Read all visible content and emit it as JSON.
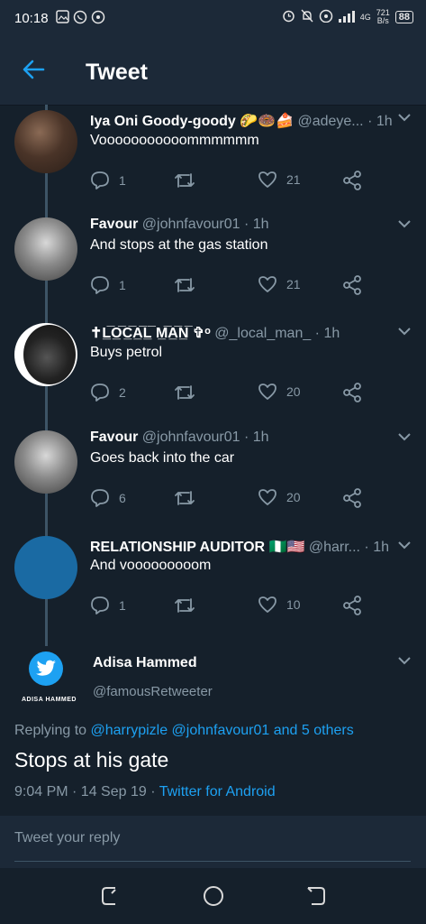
{
  "status_bar": {
    "time": "10:18",
    "net_type": "4G",
    "speed_value": "721",
    "speed_unit": "B/s",
    "battery": "88"
  },
  "header": {
    "title": "Tweet"
  },
  "tweets": [
    {
      "name": "Iya Oni Goody-goody 🌮🍩🍰",
      "handle": "@adeye... · 1h",
      "text": "Vooooooooooommmmmm",
      "replies": "1",
      "likes": "21"
    },
    {
      "name": "Favour",
      "handle": "@johnfavour01 · 1h",
      "text": "And stops at the gas station",
      "replies": "1",
      "likes": "21"
    },
    {
      "name": "✝L̲̅O̲̅C̲̅A̲̅L̲̅ M̲̅A̲̅N̲̅ ✞ᵒ",
      "handle": "@_local_man_ · 1h",
      "text": "Buys petrol",
      "replies": "2",
      "likes": "20"
    },
    {
      "name": "Favour",
      "handle": "@johnfavour01 · 1h",
      "text": "Goes back into the car",
      "replies": "6",
      "likes": "20"
    },
    {
      "name": "RELATIONSHIP AUDITOR 🇳🇬🇺🇸",
      "handle": "@harr... · 1h",
      "text": "And vooooooooom",
      "replies": "1",
      "likes": "10"
    }
  ],
  "focused_tweet": {
    "avatar_caption": "ADISA HAMMED",
    "name": "Adisa Hammed",
    "handle": "@famousRetweeter",
    "replying_prefix": "Replying to",
    "replying_to": "@harrypizle @johnfavour01 and 5 others",
    "text": "Stops at his gate",
    "timestamp": "9:04 PM · 14 Sep 19 ·",
    "source": "Twitter for Android"
  },
  "reply": {
    "placeholder": "Tweet your reply"
  },
  "colors": {
    "background": "#15202b",
    "bar": "#1c2938",
    "accent": "#1da1f2",
    "muted": "#8899a6"
  }
}
